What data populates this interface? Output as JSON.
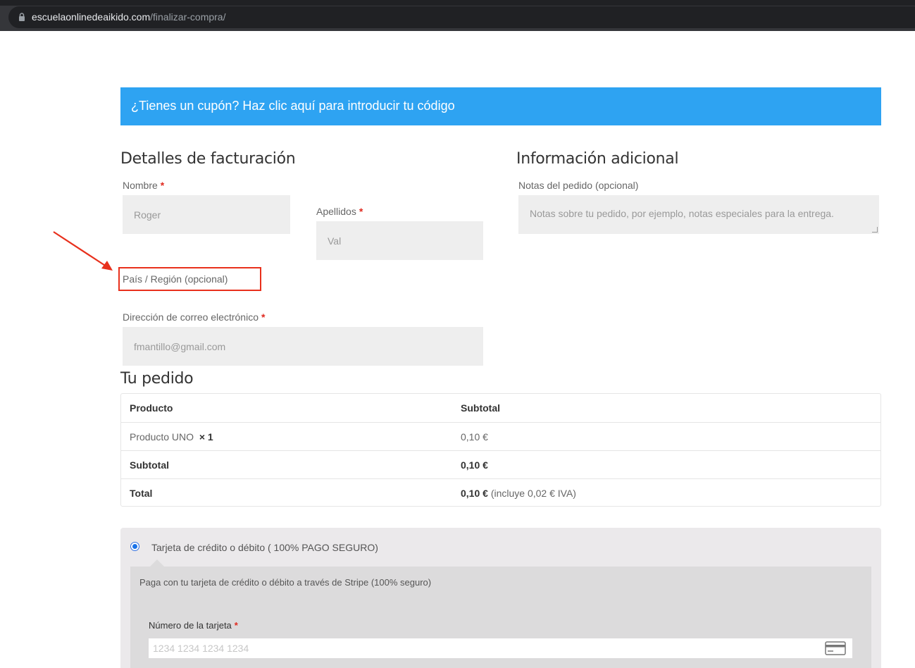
{
  "browser": {
    "url_host": "escuelaonlinedeaikido.com",
    "url_path": "/finalizar-compra/"
  },
  "coupon": {
    "text": "¿Tienes un cupón? Haz clic aquí para introducir tu código"
  },
  "billing": {
    "title": "Detalles de facturación",
    "first_name_label": "Nombre",
    "first_name_value": "Roger",
    "last_name_label": "Apellidos",
    "last_name_value": "Val",
    "country_label": "País / Región (opcional)",
    "email_label": "Dirección de correo electrónico",
    "email_value": "fmantillo@gmail.com",
    "required_mark": "*"
  },
  "additional": {
    "title": "Información adicional",
    "notes_label": "Notas del pedido (opcional)",
    "notes_placeholder": "Notas sobre tu pedido, por ejemplo, notas especiales para la entrega."
  },
  "order": {
    "title": "Tu pedido",
    "header": {
      "product": "Producto",
      "subtotal": "Subtotal"
    },
    "item": {
      "name": "Producto UNO",
      "qty": "× 1",
      "price": "0,10 €"
    },
    "subtotal": {
      "label": "Subtotal",
      "value": "0,10 €"
    },
    "total": {
      "label": "Total",
      "value": "0,10 €",
      "tax_note": "(incluye 0,02 € IVA)"
    }
  },
  "payment": {
    "method_label": "Tarjeta de crédito o débito ( 100% PAGO SEGURO)",
    "method_selected": true,
    "description": "Paga con tu tarjeta de crédito o débito a través de Stripe (100% seguro)",
    "card_number_label": "Número de la tarjeta",
    "card_number_placeholder": "1234 1234 1234 1234"
  },
  "colors": {
    "coupon_bg": "#2ea3f2",
    "required": "#e02b20",
    "annotation": "#e8301c"
  }
}
